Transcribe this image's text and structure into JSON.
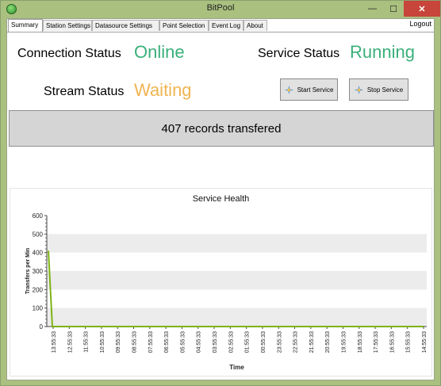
{
  "window": {
    "title": "BitPool",
    "minimize": "—",
    "maximize": "☐",
    "close": "✕"
  },
  "tabs": [
    {
      "label": "Summary",
      "active": true
    },
    {
      "label": "Station Settings",
      "active": false
    },
    {
      "label": "Datasource Settings",
      "active": false
    },
    {
      "label": "Point Selection",
      "active": false
    },
    {
      "label": "Event Log",
      "active": false
    },
    {
      "label": "About",
      "active": false
    }
  ],
  "logout_label": "Logout",
  "status": {
    "connection_label": "Connection Status",
    "connection_value": "Online",
    "service_label": "Service Status",
    "service_value": "Running",
    "stream_label": "Stream Status",
    "stream_value": "Waiting"
  },
  "buttons": {
    "start": "Start Service",
    "stop": "Stop Service"
  },
  "records_text": "407 records transfered",
  "colors": {
    "green": "#3ab07a",
    "orange": "#f0b451",
    "line": "#7db314"
  },
  "chart_data": {
    "type": "line",
    "title": "Service Health",
    "xlabel": "Time",
    "ylabel": "Transfers per Min",
    "ylim": [
      0,
      600
    ],
    "yticks": [
      0,
      100,
      200,
      300,
      400,
      500,
      600
    ],
    "x": [
      "13:55:33",
      "12:55:33",
      "11:55:33",
      "10:55:33",
      "09:55:33",
      "08:55:33",
      "07:55:33",
      "06:55:33",
      "05:55:33",
      "04:55:33",
      "03:55:33",
      "02:55:33",
      "01:55:33",
      "00:55:33",
      "23:55:33",
      "22:55:33",
      "21:55:33",
      "20:55:33",
      "19:55:33",
      "18:55:33",
      "17:55:33",
      "16:55:33",
      "15:55:33",
      "14:55:33"
    ],
    "series": [
      {
        "values": [
          410,
          0,
          0,
          0,
          0,
          0,
          0,
          0,
          0,
          0,
          0,
          0,
          0,
          0,
          0,
          0,
          0,
          0,
          0,
          0,
          0,
          0,
          0,
          0
        ]
      }
    ]
  }
}
